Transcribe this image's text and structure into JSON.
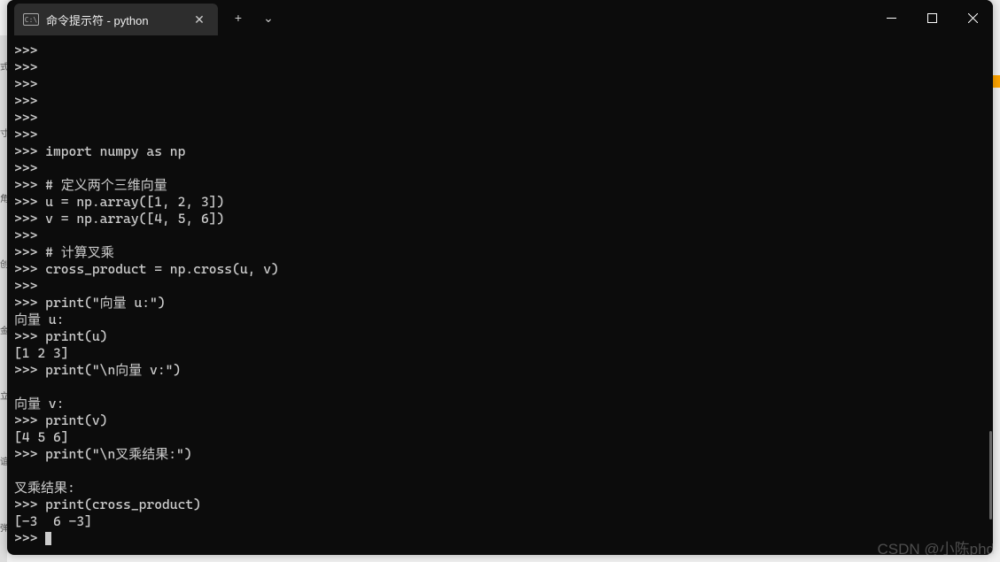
{
  "window": {
    "tab_title": "命令提示符 - python"
  },
  "bg_chars": [
    "式",
    "寸",
    "角",
    "创",
    "金",
    "立",
    "谊",
    "弹"
  ],
  "terminal_lines": [
    ">>>",
    ">>>",
    ">>>",
    ">>>",
    ">>>",
    ">>>",
    ">>> import numpy as np",
    ">>>",
    ">>> # 定义两个三维向量",
    ">>> u = np.array([1, 2, 3])",
    ">>> v = np.array([4, 5, 6])",
    ">>>",
    ">>> # 计算叉乘",
    ">>> cross_product = np.cross(u, v)",
    ">>>",
    ">>> print(\"向量 u:\")",
    "向量 u:",
    ">>> print(u)",
    "[1 2 3]",
    ">>> print(\"\\n向量 v:\")",
    "",
    "向量 v:",
    ">>> print(v)",
    "[4 5 6]",
    ">>> print(\"\\n叉乘结果:\")",
    "",
    "叉乘结果:",
    ">>> print(cross_product)",
    "[-3  6 -3]",
    ">>> "
  ],
  "watermark": "CSDN @小陈phd",
  "icons": {
    "terminal_glyph": "C:\\",
    "new_tab": "+",
    "dropdown": "⌄",
    "close_tab": "✕"
  }
}
